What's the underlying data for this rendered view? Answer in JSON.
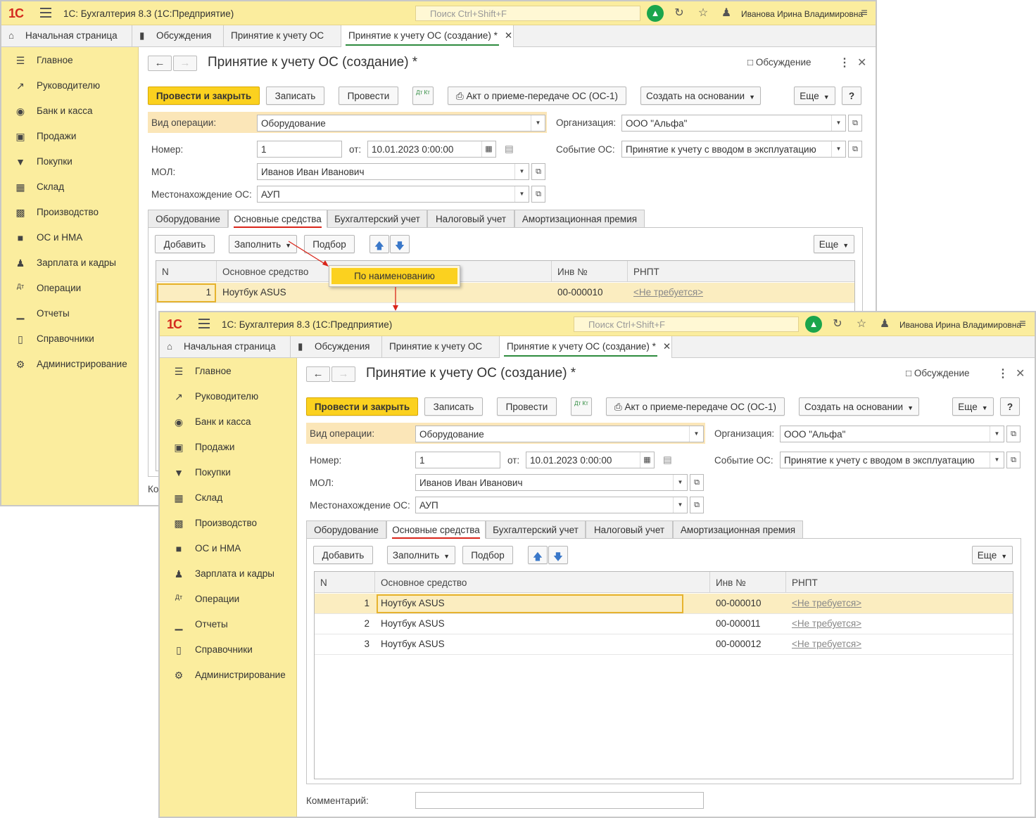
{
  "app": {
    "logo": "1С",
    "title": "1С: Бухгалтерия 8.3  (1С:Предприятие)",
    "search_placeholder": "Поиск Ctrl+Shift+F",
    "user": "Иванова Ирина Владимировна"
  },
  "page_tabs": [
    "Начальная страница",
    "Обсуждения",
    "Принятие к учету ОС",
    "Принятие к учету ОС (создание) *"
  ],
  "sidebar": [
    "Главное",
    "Руководителю",
    "Банк и касса",
    "Продажи",
    "Покупки",
    "Склад",
    "Производство",
    "ОС и НМА",
    "Зарплата и кадры",
    "Операции",
    "Отчеты",
    "Справочники",
    "Администрирование"
  ],
  "form": {
    "title": "Принятие к учету ОС (создание) *",
    "discussion": "Обсуждение",
    "toolbar": {
      "post_close": "Провести и закрыть",
      "save": "Записать",
      "post": "Провести",
      "dtkt": "Дт Кт",
      "act": "Акт о приеме-передаче ОС (ОС-1)",
      "create_based": "Создать на основании",
      "more": "Еще",
      "help": "?"
    },
    "fields": {
      "op_type_label": "Вид операции:",
      "op_type": "Оборудование",
      "org_label": "Организация:",
      "org": "ООО \"Альфа\"",
      "number_label": "Номер:",
      "number": "1",
      "date_label": "от:",
      "date": "10.01.2023  0:00:00",
      "event_label": "Событие ОС:",
      "event": "Принятие к учету с вводом в эксплуатацию",
      "mol_label": "МОЛ:",
      "mol": "Иванов Иван Иванович",
      "location_label": "Местонахождение ОС:",
      "location": "АУП",
      "comment_label": "Комментарий:",
      "comment_cut": "Ко"
    },
    "tabs": [
      "Оборудование",
      "Основные средства",
      "Бухгалтерский учет",
      "Налоговый учет",
      "Амортизационная премия"
    ],
    "table_toolbar": {
      "add": "Добавить",
      "fill": "Заполнить",
      "pick": "Подбор",
      "more": "Еще"
    },
    "columns": [
      "N",
      "Основное средство",
      "Инв №",
      "РНПТ"
    ],
    "rows_before": [
      {
        "n": "1",
        "asset": "Ноутбук ASUS",
        "inv": "00-000010",
        "rnpt": "<Не требуется>"
      }
    ],
    "rows_after": [
      {
        "n": "1",
        "asset": "Ноутбук ASUS",
        "inv": "00-000010",
        "rnpt": "<Не требуется>"
      },
      {
        "n": "2",
        "asset": "Ноутбук ASUS",
        "inv": "00-000011",
        "rnpt": "<Не требуется>"
      },
      {
        "n": "3",
        "asset": "Ноутбук ASUS",
        "inv": "00-000012",
        "rnpt": "<Не требуется>"
      }
    ],
    "popup_item": "По наименованию"
  },
  "colors": {
    "yellow": "#fbed9e",
    "accent": "#fbd11f",
    "highlight": "#fbe6b8",
    "red": "#d9251a",
    "green": "#2e8b3e"
  }
}
